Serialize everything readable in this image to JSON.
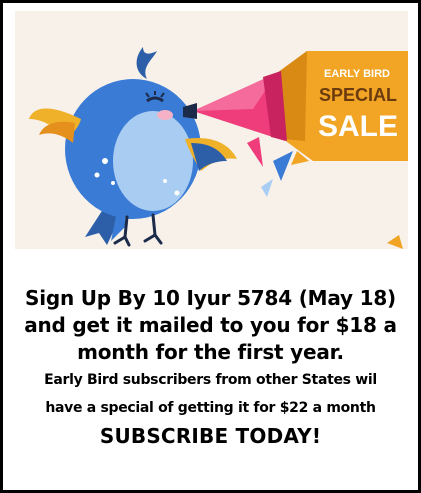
{
  "promo_badge": {
    "line1": "EARLY BIRD",
    "line2": "SPECIAL",
    "line3": "SALE"
  },
  "colors": {
    "badge": "#f2a524",
    "banner_bg": "#f7f1ea",
    "bird_blue": "#3a7bd5",
    "bird_light": "#a9cdf2",
    "megaphone": "#ee3d7a",
    "wing_accent": "#f0b12a"
  },
  "message": {
    "line1": "Sign Up By 10 Iyur 5784 (May 18)",
    "line2": "and get it mailed to you for $18 a",
    "line3": "month for the first year.",
    "line4": "Early Bird subscribers from other States wil",
    "line5": "have a special of getting it for $22 a month",
    "cta": "SUBSCRIBE TODAY!"
  }
}
